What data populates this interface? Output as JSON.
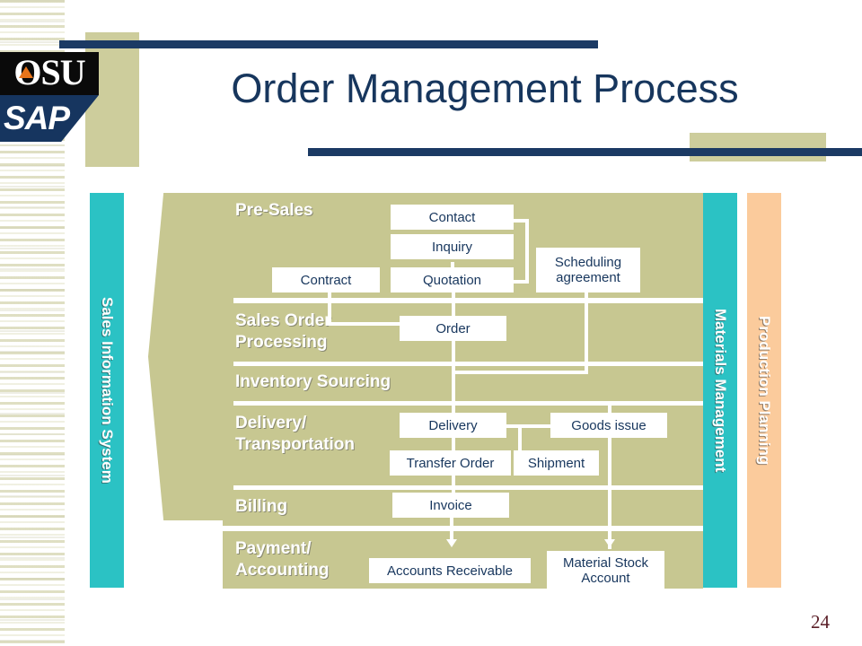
{
  "slide": {
    "title": "Order Management Process",
    "page_number": "24",
    "colors": {
      "navy": "#1b3a64",
      "title_navy": "#17365d",
      "khaki": "#c7c791",
      "khaki_block": "#cdcd9c",
      "teal": "#2bc2c4",
      "peach": "#fbcb9c",
      "box_white": "#ffffff",
      "page_number": "#5b1f28",
      "logo_orange": "#e8741a",
      "logo_navy": "#16355f"
    }
  },
  "logo": {
    "top_text": "OSU",
    "bottom_text": "SAP"
  },
  "bands": {
    "left": {
      "label": "Sales Information System"
    },
    "right_inner": {
      "label": "Materials Management"
    },
    "right_outer": {
      "label": "Production Planning"
    }
  },
  "process_rows": [
    {
      "id": "presales",
      "label": "Pre-Sales"
    },
    {
      "id": "sales_order_processing",
      "label": "Sales Order\nProcessing"
    },
    {
      "id": "inventory_sourcing",
      "label": "Inventory Sourcing"
    },
    {
      "id": "delivery_transportation",
      "label": "Delivery/\nTransportation"
    },
    {
      "id": "billing",
      "label": "Billing"
    },
    {
      "id": "payment_accounting",
      "label": "Payment/\nAccounting"
    }
  ],
  "nodes": {
    "contact": "Contact",
    "inquiry": "Inquiry",
    "quotation": "Quotation",
    "contract": "Contract",
    "scheduling_agreement": "Scheduling\nagreement",
    "order": "Order",
    "delivery": "Delivery",
    "goods_issue": "Goods issue",
    "transfer_order": "Transfer Order",
    "shipment": "Shipment",
    "invoice": "Invoice",
    "accounts_receivable": "Accounts Receivable",
    "material_stock_account": "Material Stock\nAccount"
  }
}
